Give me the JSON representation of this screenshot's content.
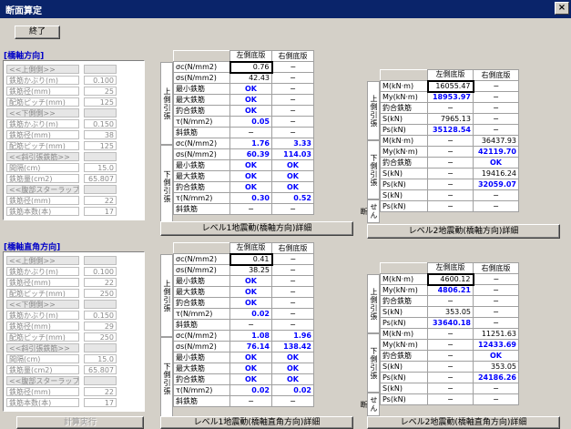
{
  "window": {
    "title": "断面算定",
    "close": "×"
  },
  "end_button": "終了",
  "sections": {
    "top_label": "[橋軸方向]",
    "bottom_label": "[橋軸直角方向]"
  },
  "left_top": [
    {
      "k": "<<上側側>>",
      "v": "",
      "hdr": true
    },
    {
      "k": "鉄筋かぶり(m)",
      "v": "0.100"
    },
    {
      "k": "鉄筋径(mm)",
      "v": "25"
    },
    {
      "k": "配筋ピッチ(mm)",
      "v": "125"
    },
    {
      "k": "<<下側側>>",
      "v": "",
      "hdr": true
    },
    {
      "k": "鉄筋かぶり(m)",
      "v": "0.150"
    },
    {
      "k": "鉄筋径(mm)",
      "v": "38"
    },
    {
      "k": "配筋ピッチ(mm)",
      "v": "125"
    },
    {
      "k": "<<斜引張鉄筋>>",
      "v": "",
      "hdr": true
    },
    {
      "k": "間隔(cm)",
      "v": "15.0"
    },
    {
      "k": "鉄筋量(cm2)",
      "v": "65.807"
    },
    {
      "k": "<<腹部スターラップ>>",
      "v": "",
      "hdr": true
    },
    {
      "k": "鉄筋径(mm)",
      "v": "22"
    },
    {
      "k": "鉄筋本数(本)",
      "v": "17"
    }
  ],
  "left_bottom": [
    {
      "k": "<<上側側>>",
      "v": "",
      "hdr": true
    },
    {
      "k": "鉄筋かぶり(m)",
      "v": "0.100"
    },
    {
      "k": "鉄筋径(mm)",
      "v": "22"
    },
    {
      "k": "配筋ピッチ(mm)",
      "v": "250"
    },
    {
      "k": "<<下側側>>",
      "v": "",
      "hdr": true
    },
    {
      "k": "鉄筋かぶり(m)",
      "v": "0.150"
    },
    {
      "k": "鉄筋径(mm)",
      "v": "29"
    },
    {
      "k": "配筋ピッチ(mm)",
      "v": "250"
    },
    {
      "k": "<<斜引張鉄筋>>",
      "v": "",
      "hdr": true
    },
    {
      "k": "間隔(cm)",
      "v": "15.0"
    },
    {
      "k": "鉄筋量(cm2)",
      "v": "65.807"
    },
    {
      "k": "<<腹部スターラップ>>",
      "v": "",
      "hdr": true
    },
    {
      "k": "鉄筋径(mm)",
      "v": "22"
    },
    {
      "k": "鉄筋本数(本)",
      "v": "17"
    }
  ],
  "l1_headers": [
    "左側底版",
    "右側底版"
  ],
  "l1_side": {
    "upper": "上側引張",
    "lower": "下側引張"
  },
  "l1_top": {
    "upper": [
      {
        "k": "σc(N/mm2)",
        "l": "0.76",
        "r": "−",
        "lb": false
      },
      {
        "k": "σs(N/mm2)",
        "l": "42.43",
        "r": "−",
        "lb": false
      },
      {
        "k": "最小鉄筋",
        "l": "OK",
        "r": "−",
        "lb": true
      },
      {
        "k": "最大鉄筋",
        "l": "OK",
        "r": "−",
        "lb": true
      },
      {
        "k": "釣合鉄筋",
        "l": "OK",
        "r": "−",
        "lb": true
      },
      {
        "k": "τ(N/mm2)",
        "l": "0.05",
        "r": "−",
        "lb": true
      },
      {
        "k": "斜鉄筋",
        "l": "−",
        "r": "−",
        "lb": false
      }
    ],
    "lower": [
      {
        "k": "σc(N/mm2)",
        "l": "1.76",
        "r": "3.33",
        "lb": true
      },
      {
        "k": "σs(N/mm2)",
        "l": "60.39",
        "r": "114.03",
        "lb": true
      },
      {
        "k": "最小鉄筋",
        "l": "OK",
        "r": "OK",
        "lb": true
      },
      {
        "k": "最大鉄筋",
        "l": "OK",
        "r": "OK",
        "lb": true
      },
      {
        "k": "釣合鉄筋",
        "l": "OK",
        "r": "OK",
        "lb": true
      },
      {
        "k": "τ(N/mm2)",
        "l": "0.30",
        "r": "0.52",
        "lb": true
      },
      {
        "k": "斜鉄筋",
        "l": "−",
        "r": "−",
        "lb": false
      }
    ]
  },
  "l1_bottom": {
    "upper": [
      {
        "k": "σc(N/mm2)",
        "l": "0.41",
        "r": "−",
        "lb": false
      },
      {
        "k": "σs(N/mm2)",
        "l": "38.25",
        "r": "−",
        "lb": false
      },
      {
        "k": "最小鉄筋",
        "l": "OK",
        "r": "−",
        "lb": true
      },
      {
        "k": "最大鉄筋",
        "l": "OK",
        "r": "−",
        "lb": true
      },
      {
        "k": "釣合鉄筋",
        "l": "OK",
        "r": "−",
        "lb": true
      },
      {
        "k": "τ(N/mm2)",
        "l": "0.02",
        "r": "−",
        "lb": true
      },
      {
        "k": "斜鉄筋",
        "l": "−",
        "r": "−",
        "lb": false
      }
    ],
    "lower": [
      {
        "k": "σc(N/mm2)",
        "l": "1.08",
        "r": "1.96",
        "lb": true
      },
      {
        "k": "σs(N/mm2)",
        "l": "76.14",
        "r": "138.42",
        "lb": true
      },
      {
        "k": "最小鉄筋",
        "l": "OK",
        "r": "OK",
        "lb": true
      },
      {
        "k": "最大鉄筋",
        "l": "OK",
        "r": "OK",
        "lb": true
      },
      {
        "k": "釣合鉄筋",
        "l": "OK",
        "r": "OK",
        "lb": true
      },
      {
        "k": "τ(N/mm2)",
        "l": "0.02",
        "r": "0.02",
        "lb": true
      },
      {
        "k": "斜鉄筋",
        "l": "−",
        "r": "−",
        "lb": false
      }
    ]
  },
  "l2_headers": [
    "左側底版",
    "右側底版"
  ],
  "l2_side": {
    "upper": "上側引張",
    "lower": "下側引張",
    "sh": "せん断"
  },
  "l2_top": {
    "upper": [
      {
        "k": "M(kN·m)",
        "l": "16055.47",
        "r": "−",
        "lb": false
      },
      {
        "k": "My(kN·m)",
        "l": "18953.97",
        "r": "−",
        "lb": true
      },
      {
        "k": "釣合鉄筋",
        "l": "−",
        "r": "−",
        "lb": false
      },
      {
        "k": "S(kN)",
        "l": "7965.13",
        "r": "−",
        "lb": false
      },
      {
        "k": "Ps(kN)",
        "l": "35128.54",
        "r": "−",
        "lb": true
      }
    ],
    "lower": [
      {
        "k": "M(kN·m)",
        "l": "−",
        "r": "36437.93",
        "lb": false
      },
      {
        "k": "My(kN·m)",
        "l": "−",
        "r": "42119.70",
        "lb": true
      },
      {
        "k": "釣合鉄筋",
        "l": "−",
        "r": "OK",
        "lb": true
      },
      {
        "k": "S(kN)",
        "l": "−",
        "r": "19416.24",
        "lb": false
      },
      {
        "k": "Ps(kN)",
        "l": "−",
        "r": "32059.07",
        "lb": true
      }
    ],
    "sh": [
      {
        "k": "S(kN)",
        "l": "−",
        "r": "−",
        "lb": false
      },
      {
        "k": "Ps(kN)",
        "l": "−",
        "r": "−",
        "lb": false
      }
    ]
  },
  "l2_bottom": {
    "upper": [
      {
        "k": "M(kN·m)",
        "l": "4600.12",
        "r": "−",
        "lb": false
      },
      {
        "k": "My(kN·m)",
        "l": "4806.21",
        "r": "−",
        "lb": true
      },
      {
        "k": "釣合鉄筋",
        "l": "−",
        "r": "−",
        "lb": false
      },
      {
        "k": "S(kN)",
        "l": "353.05",
        "r": "−",
        "lb": false
      },
      {
        "k": "Ps(kN)",
        "l": "33640.18",
        "r": "−",
        "lb": true
      }
    ],
    "lower": [
      {
        "k": "M(kN·m)",
        "l": "−",
        "r": "11251.63",
        "lb": false
      },
      {
        "k": "My(kN·m)",
        "l": "−",
        "r": "12433.69",
        "lb": true
      },
      {
        "k": "釣合鉄筋",
        "l": "−",
        "r": "OK",
        "lb": true
      },
      {
        "k": "S(kN)",
        "l": "−",
        "r": "353.05",
        "lb": false
      },
      {
        "k": "Ps(kN)",
        "l": "−",
        "r": "24186.26",
        "lb": true
      }
    ],
    "sh": [
      {
        "k": "S(kN)",
        "l": "−",
        "r": "−",
        "lb": false
      },
      {
        "k": "Ps(kN)",
        "l": "−",
        "r": "−",
        "lb": false
      }
    ]
  },
  "buttons": {
    "l1_top": "レベル1地震動(橋軸方向)詳細",
    "l2_top": "レベル2地震動(橋軸方向)詳細",
    "calc": "計算実行",
    "l1_bottom": "レベル1地震動(橋軸直角方向)詳細",
    "l2_bottom": "レベル2地震動(橋軸直角方向)詳細"
  }
}
